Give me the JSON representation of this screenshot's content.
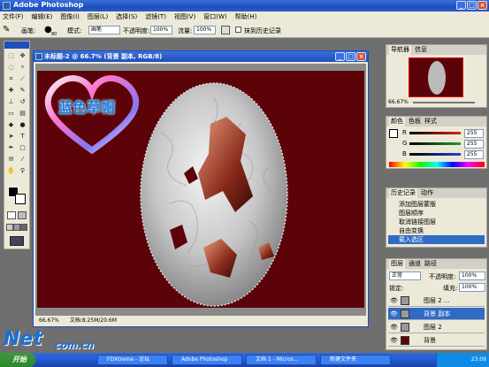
{
  "app": {
    "title": "Adobe Photoshop"
  },
  "menu": [
    "文件(F)",
    "编辑(E)",
    "图像(I)",
    "图层(L)",
    "选择(S)",
    "滤镜(T)",
    "视图(V)",
    "窗口(W)",
    "帮助(H)"
  ],
  "options": {
    "brush_label": "画笔:",
    "brush_size": "80",
    "mode_label": "模式:",
    "mode_value": "画笔",
    "opacity_label": "不透明度:",
    "opacity_value": "100%",
    "flow_label": "流量:",
    "flow_value": "100%",
    "history_label": "抹到历史记录"
  },
  "document": {
    "title": "未标题-2 @ 66.7% (背景 副本, RGB/8)",
    "status": "66.67%",
    "status_doc": "文档:8.25M/20.6M"
  },
  "heart_text": "蓝色草帽",
  "navigator": {
    "tabs": [
      "导航器",
      "信息"
    ],
    "zoom": "66.67%"
  },
  "color": {
    "tabs": [
      "颜色",
      "色板",
      "样式"
    ],
    "channels": [
      {
        "name": "R",
        "value": "255"
      },
      {
        "name": "G",
        "value": "255"
      },
      {
        "name": "B",
        "value": "255"
      }
    ]
  },
  "history": {
    "tabs": [
      "历史记录",
      "动作"
    ],
    "items": [
      "添加图层蒙版",
      "图层顺序",
      "取消链接图层",
      "自由变换",
      "载入选区"
    ]
  },
  "layers": {
    "tabs": [
      "图层",
      "通道",
      "路径"
    ],
    "blend_mode": "正常",
    "opacity_label": "不透明度:",
    "opacity_value": "100%",
    "lock_label": "锁定:",
    "fill_label": "填充:",
    "fill_value": "100%",
    "items": [
      {
        "name": "图层 2 ..."
      },
      {
        "name": "背景 副本"
      },
      {
        "name": "图层 2"
      },
      {
        "name": "背景"
      }
    ]
  },
  "taskbar": {
    "start": "开始",
    "items": [
      "FDXtreme - 论坛",
      "Adobe Photoshop",
      "文档 1 - Micros...",
      "新建文件夹"
    ],
    "clock": "23:09"
  },
  "watermark": {
    "brand": "Net",
    "domain": "com.cn"
  },
  "colors": {
    "canvas_bg": "#5c0209",
    "title_blue": "#1c4fbf",
    "heart_text": "#1a7ae0"
  }
}
